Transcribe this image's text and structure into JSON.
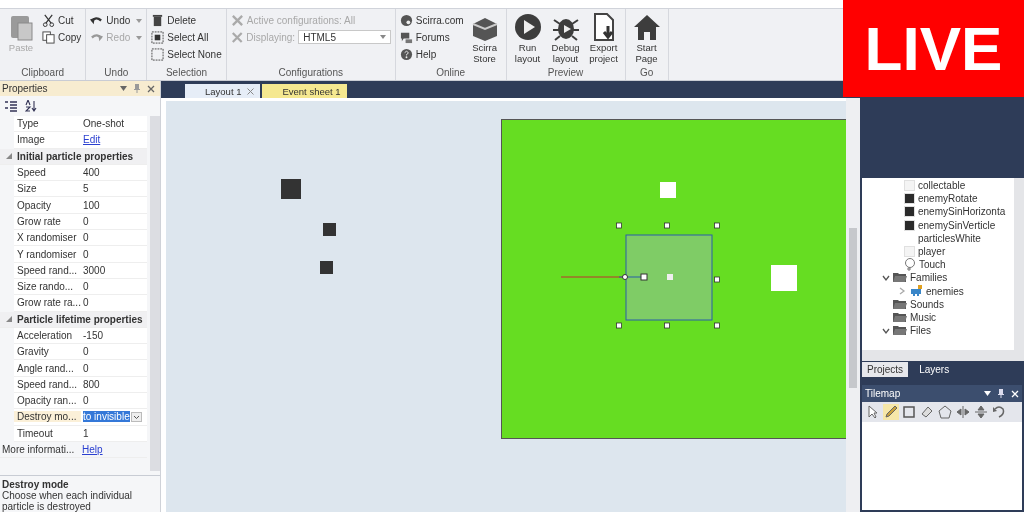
{
  "ribbon": {
    "groups": [
      {
        "label": "Clipboard",
        "buttons": [
          {
            "label": "Paste",
            "kind": "paste",
            "disabled": true
          },
          {
            "label": "Cut",
            "kind": "cut",
            "disabled": false
          },
          {
            "label": "Copy",
            "kind": "copy",
            "disabled": false
          }
        ]
      },
      {
        "label": "Undo",
        "buttons": [
          {
            "label": "Undo",
            "kind": "undo",
            "disabled": false,
            "menu": true
          },
          {
            "label": "Redo",
            "kind": "redo",
            "disabled": true,
            "menu": true
          }
        ]
      },
      {
        "label": "Selection",
        "buttons": [
          {
            "label": "Delete",
            "kind": "delete",
            "disabled": false
          },
          {
            "label": "Select All",
            "kind": "select-all",
            "disabled": false
          },
          {
            "label": "Select None",
            "kind": "select-none",
            "disabled": false
          }
        ]
      },
      {
        "label": "Configurations",
        "buttons": [
          {
            "label": "Active configurations: All",
            "kind": "config",
            "disabled": true
          },
          {
            "label": "Displaying:",
            "kind": "display",
            "disabled": true,
            "value": "HTML5"
          }
        ]
      },
      {
        "label": "Online",
        "buttons": [
          {
            "label": "Scirra.com",
            "kind": "web",
            "disabled": false
          },
          {
            "label": "Forums",
            "kind": "forums",
            "disabled": false
          },
          {
            "label": "Help",
            "kind": "help",
            "disabled": false
          },
          {
            "label": "Scirra Store",
            "kind": "store",
            "disabled": false
          }
        ]
      },
      {
        "label": "Preview",
        "buttons": [
          {
            "label": "Run layout",
            "kind": "run",
            "disabled": false
          },
          {
            "label": "Debug layout",
            "kind": "debug",
            "disabled": false
          },
          {
            "label": "Export project",
            "kind": "export",
            "disabled": false
          }
        ]
      },
      {
        "label": "Go",
        "buttons": [
          {
            "label": "Start Page",
            "kind": "home",
            "disabled": false
          }
        ]
      }
    ]
  },
  "properties": {
    "title": "Properties",
    "rows": [
      {
        "kind": "property",
        "name": "Type",
        "value": "One-shot",
        "selected": false
      },
      {
        "kind": "link",
        "name": "Image",
        "value": "Edit",
        "selected": false
      },
      {
        "kind": "section",
        "name": "Initial particle properties",
        "expanded": true
      },
      {
        "kind": "property",
        "name": "Speed",
        "value": "400",
        "selected": false
      },
      {
        "kind": "property",
        "name": "Size",
        "value": "5",
        "selected": false
      },
      {
        "kind": "property",
        "name": "Opacity",
        "value": "100",
        "selected": false
      },
      {
        "kind": "property",
        "name": "Grow rate",
        "value": "0",
        "selected": false
      },
      {
        "kind": "property",
        "name": "X randomiser",
        "value": "0",
        "selected": false
      },
      {
        "kind": "property",
        "name": "Y randomiser",
        "value": "0",
        "selected": false
      },
      {
        "kind": "property",
        "name": "Speed rand...",
        "value": "3000",
        "selected": false
      },
      {
        "kind": "property",
        "name": "Size rando...",
        "value": "0",
        "selected": false
      },
      {
        "kind": "property",
        "name": "Grow rate ra...",
        "value": "0",
        "selected": false
      },
      {
        "kind": "section",
        "name": "Particle lifetime properties",
        "expanded": true
      },
      {
        "kind": "property",
        "name": "Acceleration",
        "value": "-150",
        "selected": false
      },
      {
        "kind": "property",
        "name": "Gravity",
        "value": "0",
        "selected": false
      },
      {
        "kind": "property",
        "name": "Angle rand...",
        "value": "0",
        "selected": false
      },
      {
        "kind": "property",
        "name": "Speed rand...",
        "value": "800",
        "selected": false
      },
      {
        "kind": "property",
        "name": "Opacity ran...",
        "value": "0",
        "selected": false
      },
      {
        "kind": "dropdown",
        "name": "Destroy mo...",
        "value": "to invisible",
        "selected": true
      },
      {
        "kind": "property",
        "name": "Timeout",
        "value": "1",
        "selected": false
      },
      {
        "kind": "info",
        "name": "More informati...",
        "value": "Help",
        "selected": false
      }
    ],
    "description": {
      "title": "Destroy mode",
      "text": "Choose when each individual particle is destroyed"
    }
  },
  "document_tabs": [
    {
      "label": "Layout 1",
      "selected": true,
      "closable": true
    },
    {
      "label": "Event sheet 1",
      "selected": false,
      "closable": false
    }
  ],
  "project_tree": {
    "object_types": [
      {
        "label": "collectable",
        "kind": "sprite",
        "color": "#f4f4f4"
      },
      {
        "label": "enemyRotate",
        "kind": "sprite",
        "color": "#2a2a2a"
      },
      {
        "label": "enemySinHorizonta",
        "kind": "sprite",
        "color": "#2a2a2a"
      },
      {
        "label": "enemySinVerticle",
        "kind": "sprite",
        "color": "#2a2a2a"
      },
      {
        "label": "particlesWhite",
        "kind": "sprite"
      },
      {
        "label": "player",
        "kind": "sprite",
        "color": "#f4f4f4"
      },
      {
        "label": "Touch",
        "kind": "touch"
      }
    ],
    "folders": [
      {
        "label": "Families",
        "kind": "folder",
        "expanded": true,
        "children": [
          {
            "label": "enemies",
            "kind": "family",
            "expanded": false
          }
        ]
      },
      {
        "label": "Sounds",
        "kind": "folder",
        "expanded": false
      },
      {
        "label": "Music",
        "kind": "folder",
        "expanded": false
      },
      {
        "label": "Files",
        "kind": "folder",
        "expanded": true
      }
    ]
  },
  "panel_tabs": [
    {
      "label": "Projects",
      "selected": true
    },
    {
      "label": "Layers",
      "selected": false
    }
  ],
  "tilemap": {
    "title": "Tilemap",
    "tools": [
      {
        "kind": "pointer",
        "selected": false
      },
      {
        "kind": "pencil",
        "selected": true
      },
      {
        "kind": "rectangle",
        "selected": false
      },
      {
        "kind": "eraser",
        "selected": false
      },
      {
        "kind": "stamp",
        "selected": false
      },
      {
        "kind": "flip-h",
        "selected": false
      },
      {
        "kind": "flip-v",
        "selected": false
      },
      {
        "kind": "rotate",
        "selected": false
      }
    ]
  },
  "live_badge": {
    "label": "LIVE"
  }
}
